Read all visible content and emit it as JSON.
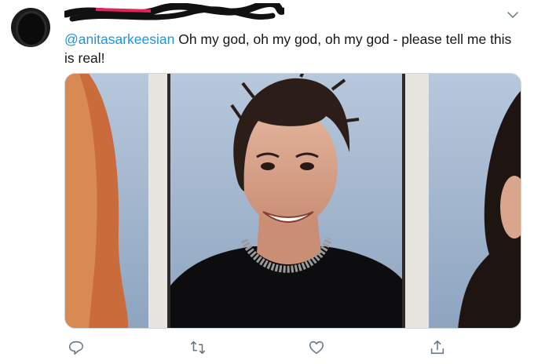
{
  "tweet": {
    "mention": "@anitasarkeesian",
    "text": " Oh my god, oh my god, oh my god - please tell me this is real!"
  },
  "media": {
    "description_icon": "yearbook-photo",
    "colors": {
      "backdrop": "#a9bed6",
      "border_strip": "#e6e3df",
      "shirt": "#0d0d0f",
      "hair": "#2b1d17"
    }
  },
  "actions": [
    "reply-icon",
    "retweet-icon",
    "like-icon",
    "share-icon"
  ]
}
